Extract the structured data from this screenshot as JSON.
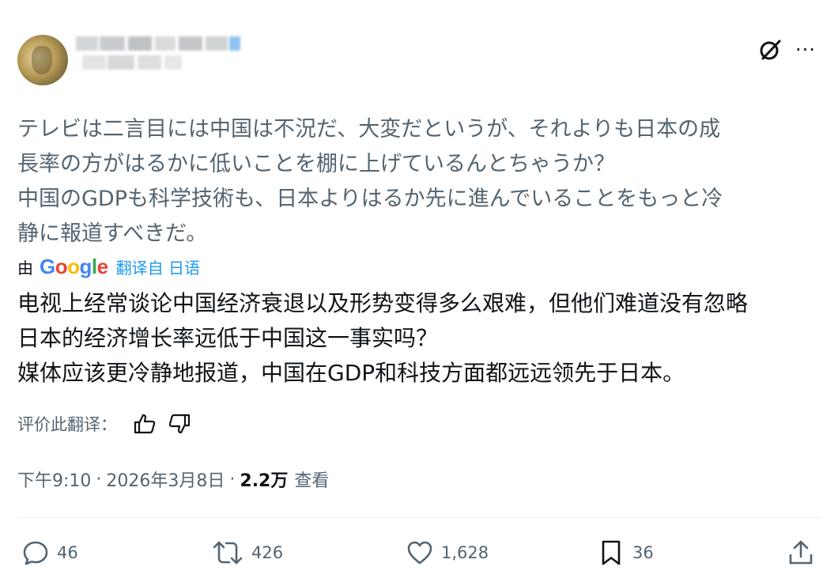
{
  "post": {
    "original_text": "テレビは二言目には中国は不況だ、大変だというが、それよりも日本の成\n長率の方がはるかに低いことを棚に上げているんとちゃうか？\n中国のGDPも科学技術も、日本よりはるか先に進んでいることをもっと冷\n静に報道すべきだ。",
    "translation_prefix": "由",
    "translation_brand": "Google",
    "translation_link": "翻译自 日语",
    "translated_text": "电视上经常谈论中国经济衰退以及形势变得多么艰难，但他们难道没有忽略\n日本的经济增长率远低于中国这一事实吗？\n媒体应该更冷静地报道，中国在GDP和科技方面都远远领先于日本。",
    "rate_label": "评价此翻译：",
    "time": "下午9:10",
    "date": "2026年3月8日",
    "views_count": "2.2万",
    "views_label": "查看",
    "sep": "·"
  },
  "header": {
    "more_label": "···"
  },
  "actions": {
    "reply_count": "46",
    "repost_count": "426",
    "like_count": "1,628",
    "bookmark_count": "36"
  },
  "icons": {
    "grok": "grok-icon",
    "more": "more-icon",
    "thumbs_up": "thumbs-up-icon",
    "thumbs_down": "thumbs-down-icon",
    "reply": "reply-icon",
    "repost": "repost-icon",
    "like": "heart-icon",
    "bookmark": "bookmark-icon",
    "share": "share-icon"
  },
  "colors": {
    "text": "#0f1419",
    "secondary": "#536471",
    "link": "#1d9bf0"
  }
}
